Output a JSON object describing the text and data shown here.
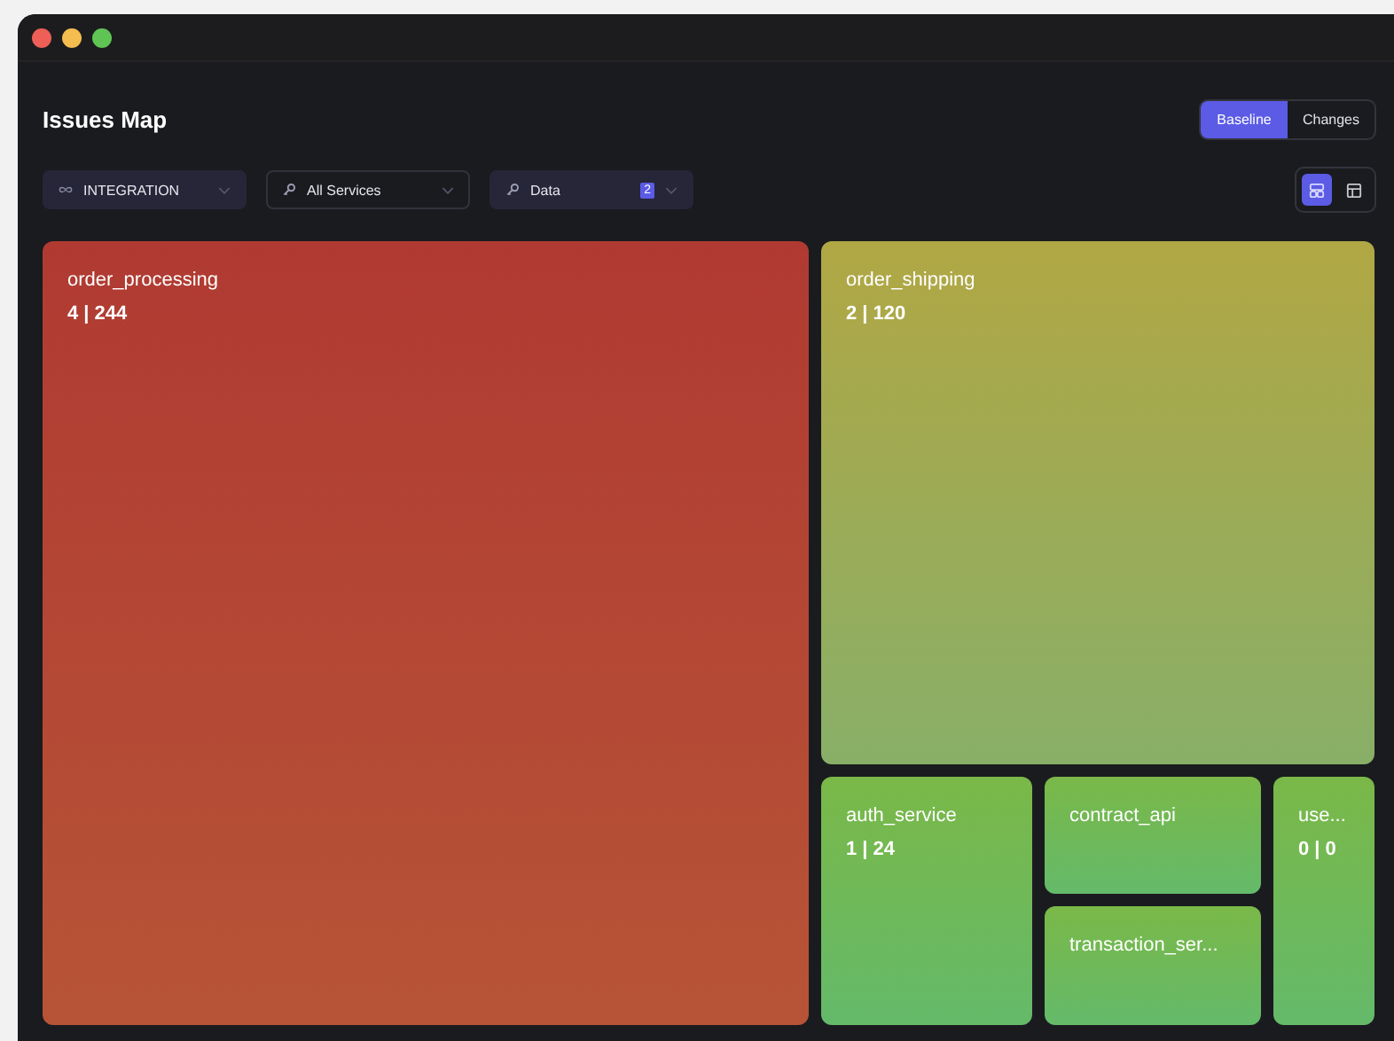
{
  "title": "Issues Map",
  "modes": [
    {
      "label": "Baseline",
      "selected": true
    },
    {
      "label": "Changes",
      "selected": false
    }
  ],
  "filters": [
    {
      "kind": "environment",
      "value": "INTEGRATION"
    },
    {
      "kind": "service",
      "value": "All Services"
    },
    {
      "kind": "data",
      "value": "Data",
      "badge": "2"
    }
  ],
  "views": [
    {
      "kind": "treemap",
      "selected": true
    },
    {
      "kind": "table",
      "selected": false
    }
  ],
  "tiles": [
    {
      "name": "order_processing",
      "value": "4 | 244",
      "color": "#b03a32"
    },
    {
      "name": "order_shipping",
      "value": "2 | 120",
      "color": "#b1a744"
    },
    {
      "name": "auth_service",
      "value": "1 | 24",
      "color": "#7ab848"
    },
    {
      "name": "contract_api",
      "color": "#7ab848"
    },
    {
      "name": "transaction_ser...",
      "color": "#7ab848"
    },
    {
      "name": "use...",
      "value": "0 | 0",
      "color": "#7ab848"
    }
  ]
}
